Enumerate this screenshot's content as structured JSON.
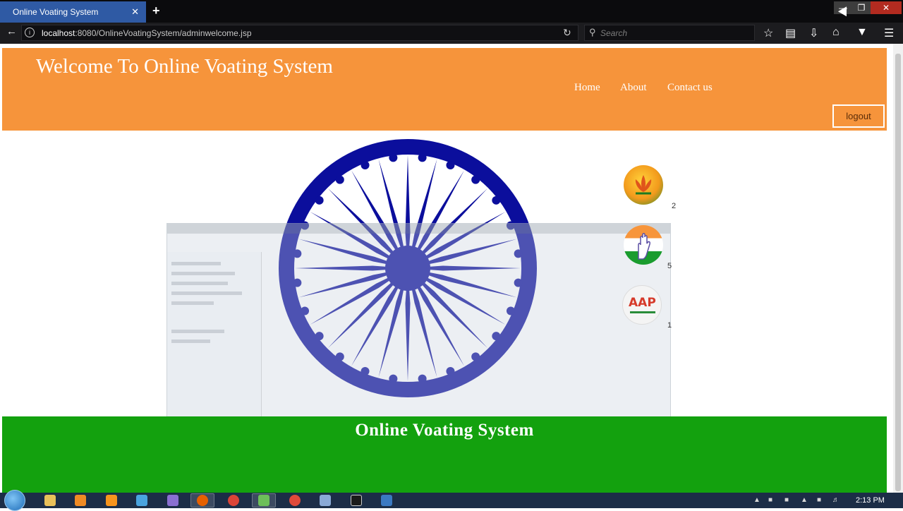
{
  "browser": {
    "tab_title": "Online Voating System",
    "tab_close": "✕",
    "new_tab": "+",
    "url_host": "localhost",
    "url_rest": ":8080/OnlineVoatingSystem/adminwelcome.jsp",
    "search_placeholder": "Search",
    "window_controls": {
      "minimize": "—",
      "maximize": "❐",
      "close": "✕"
    }
  },
  "site": {
    "title": "Welcome To Online Voating System",
    "nav": {
      "home": "Home",
      "about": "About",
      "contact": "Contact us"
    },
    "logout": "logout",
    "footer_title": "Online Voating System"
  },
  "parties": [
    {
      "name": "BJP",
      "count": "2"
    },
    {
      "name": "INC",
      "count": "5"
    },
    {
      "name": "AAP",
      "count": "1",
      "logo_text": "AAP"
    }
  ],
  "taskbar": {
    "clock": "2:13 PM"
  },
  "colors": {
    "saffron": "#f6943b",
    "green": "#13a10e",
    "chakra_blue": "#0b0e9c",
    "tab_blue": "#2f5aa4"
  }
}
